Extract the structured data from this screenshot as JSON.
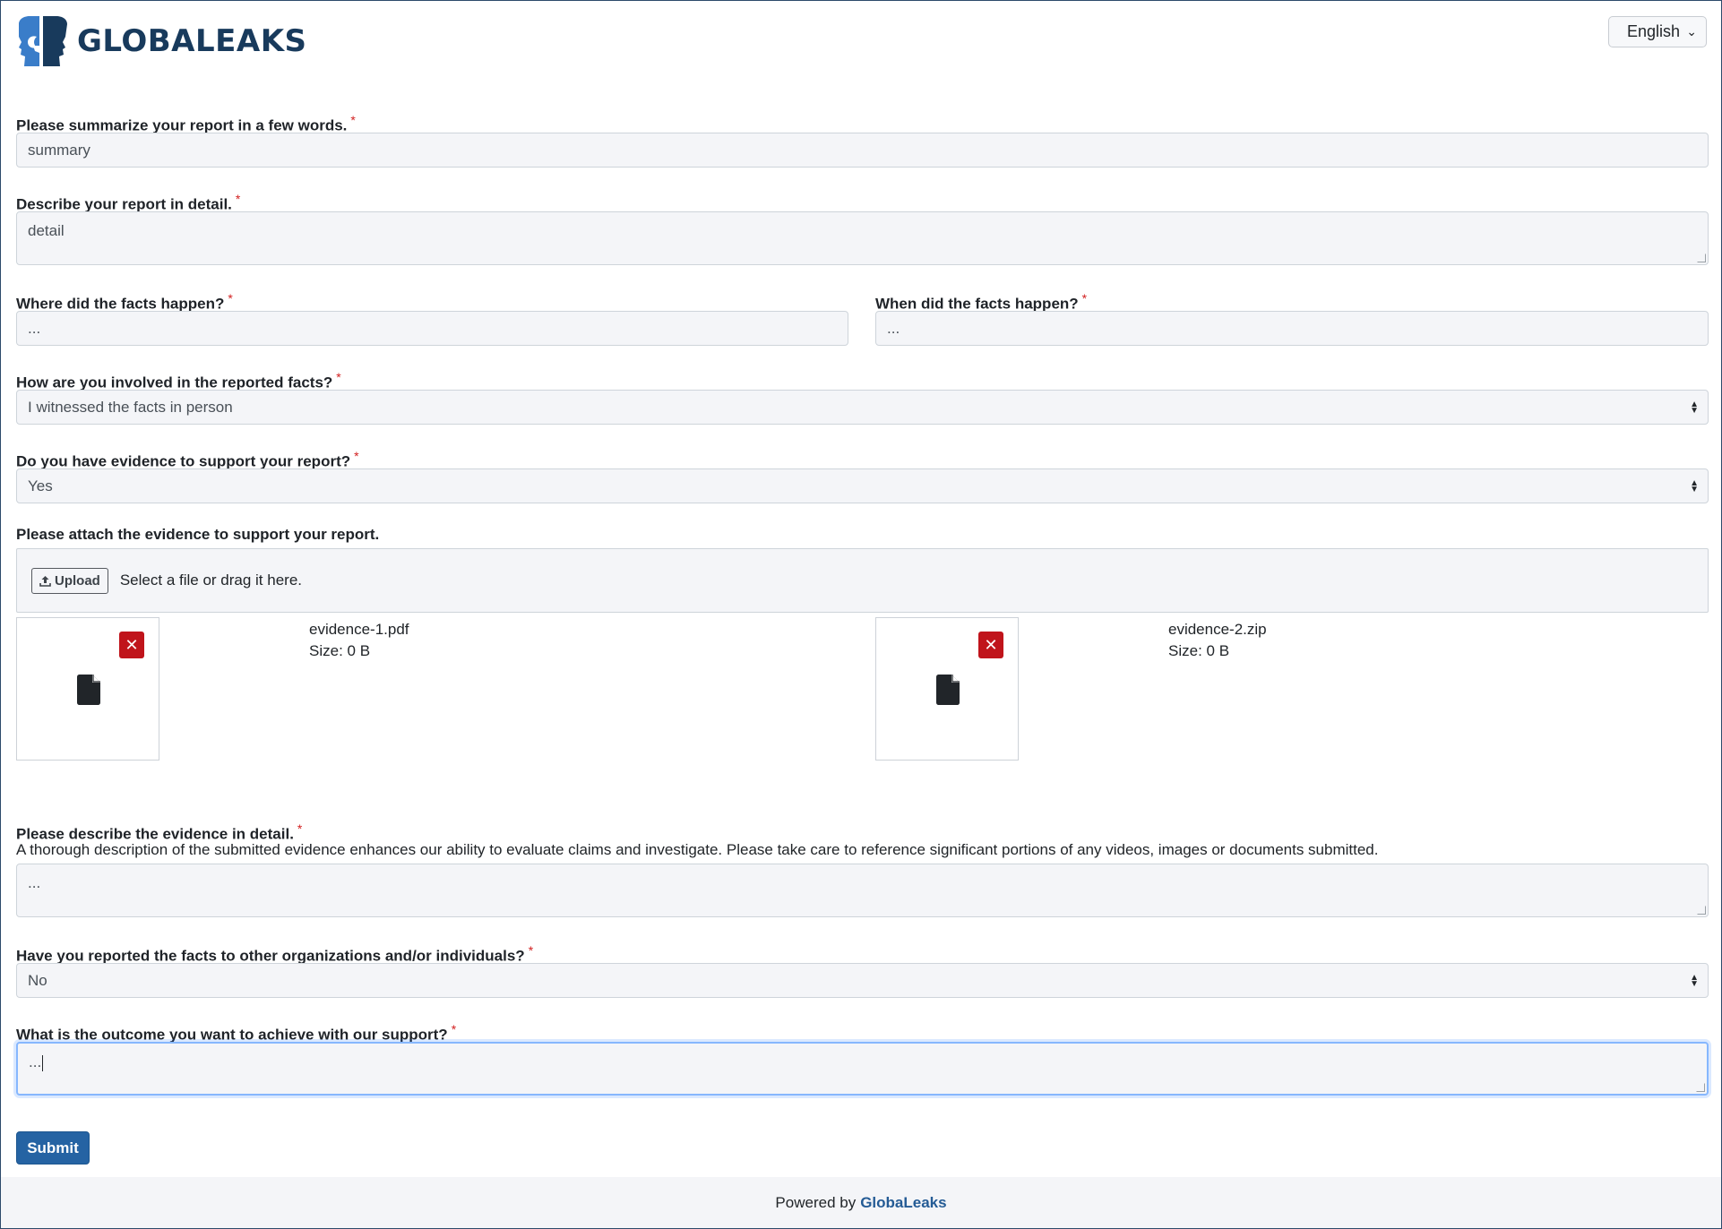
{
  "header": {
    "logo_text": "GLOBALEAKS",
    "language": "English"
  },
  "fields": {
    "summary": {
      "label": "Please summarize your report in a few words.",
      "required_mark": "*",
      "value": "summary"
    },
    "detail": {
      "label": "Describe your report in detail.",
      "required_mark": "*",
      "value": "detail"
    },
    "where": {
      "label": "Where did the facts happen?",
      "required_mark": "*",
      "value": "..."
    },
    "when": {
      "label": "When did the facts happen?",
      "required_mark": "*",
      "value": "..."
    },
    "involvement": {
      "label": "How are you involved in the reported facts?",
      "required_mark": "*",
      "value": "I witnessed the facts in person"
    },
    "has_evidence": {
      "label": "Do you have evidence to support your report?",
      "required_mark": "*",
      "value": "Yes"
    },
    "attachments": {
      "label": "Please attach the evidence to support your report.",
      "upload_label": "Upload",
      "drop_text": "Select a file or drag it here.",
      "files": [
        {
          "name": "evidence-1.pdf",
          "size": "Size: 0 B"
        },
        {
          "name": "evidence-2.zip",
          "size": "Size: 0 B"
        }
      ]
    },
    "evidence_description": {
      "label": "Please describe the evidence in detail.",
      "required_mark": "*",
      "hint": "A thorough description of the submitted evidence enhances our ability to evaluate claims and investigate. Please take care to reference significant portions of any videos, images or documents submitted.",
      "value": "..."
    },
    "reported_elsewhere": {
      "label": "Have you reported the facts to other organizations and/or individuals?",
      "required_mark": "*",
      "value": "No"
    },
    "outcome": {
      "label": "What is the outcome you want to achieve with our support?",
      "required_mark": "*",
      "value": "..."
    }
  },
  "submit_label": "Submit",
  "footer": {
    "prefix": "Powered by",
    "link": "GlobaLeaks"
  },
  "colors": {
    "brand": "#183a5c",
    "primary": "#2563a3",
    "danger": "#c0141b",
    "required": "#d21f1f"
  }
}
